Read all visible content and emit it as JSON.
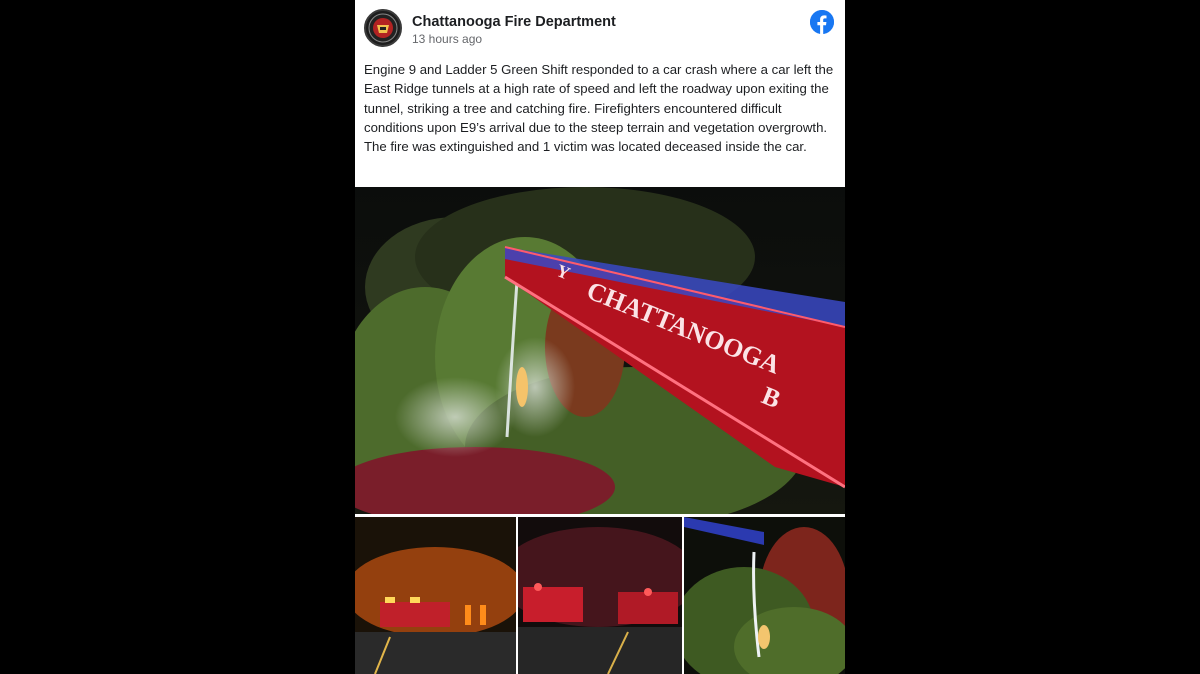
{
  "post": {
    "page_name": "Chattanooga Fire Department",
    "timestamp": "13 hours ago",
    "text": "Engine 9 and Ladder 5 Green Shift responded to a car crash where a car left the East Ridge tunnels at a high rate of speed and left the roadway upon exiting the tunnel, striking a tree and catching fire. Firefighters encountered difficult conditions upon E9’s arrival due to the steep terrain and vegetation overgrowth. The fire was extinguished and 1 victim was located deceased inside the car.",
    "ladder_text": "CHATTANOOGA",
    "ladder_text_2": "Y",
    "ladder_text_3": "B"
  },
  "icons": {
    "facebook": "facebook-icon",
    "avatar": "fire-department-badge"
  },
  "colors": {
    "facebook_blue": "#1877f2",
    "text": "#1c1e21",
    "muted": "#65676b"
  }
}
